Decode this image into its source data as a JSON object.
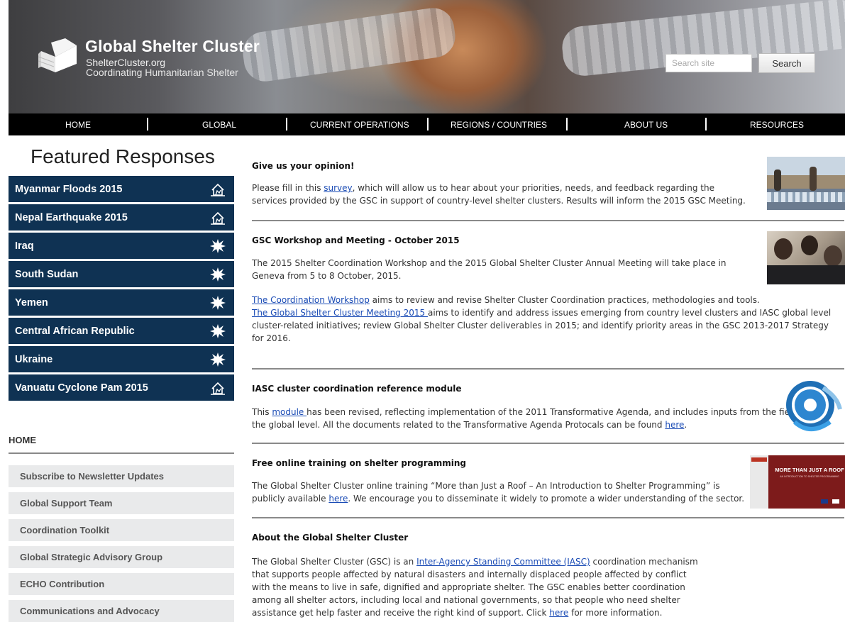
{
  "header": {
    "site_title": "Global Shelter Cluster",
    "site_url": "ShelterCluster.org",
    "tagline": "Coordinating Humanitarian Shelter",
    "search_placeholder": "Search site",
    "search_button": "Search"
  },
  "nav": [
    "HOME",
    "GLOBAL",
    "CURRENT OPERATIONS",
    "REGIONS / COUNTRIES",
    "ABOUT US",
    "RESOURCES"
  ],
  "sidebar": {
    "featured_heading": "Featured Responses",
    "responses": [
      {
        "label": "Myanmar Floods 2015",
        "icon": "house-disaster-icon"
      },
      {
        "label": "Nepal Earthquake 2015",
        "icon": "house-disaster-icon"
      },
      {
        "label": "Iraq",
        "icon": "burst-icon"
      },
      {
        "label": "South Sudan",
        "icon": "burst-icon"
      },
      {
        "label": "Yemen",
        "icon": "burst-icon"
      },
      {
        "label": "Central African Republic",
        "icon": "burst-icon"
      },
      {
        "label": "Ukraine",
        "icon": "burst-icon"
      },
      {
        "label": "Vanuatu Cyclone Pam 2015",
        "icon": "house-disaster-icon"
      }
    ],
    "home_heading": "HOME",
    "links": [
      "Subscribe to Newsletter Updates",
      "Global Support Team",
      "Coordination Toolkit",
      "Global Strategic Advisory Group",
      "ECHO Contribution",
      "Communications and Advocacy"
    ]
  },
  "posts": {
    "opinion": {
      "title": "Give us your opinion!",
      "p1_a": "Please fill in this ",
      "p1_link": "survey",
      "p1_b": ", which will allow us to hear about your priorities, needs, and feedback regarding the services provided by the GSC in support of country-level shelter clusters. Results will inform the 2015 GSC Meeting."
    },
    "workshop": {
      "title": "GSC Workshop and Meeting - October 2015",
      "p1": "The 2015 Shelter Coordination Workshop and the 2015 Global Shelter Cluster Annual Meeting will take place in Geneva from 5 to 8 October, 2015.",
      "link1": "The Coordination Workshop",
      "text1": " aims to review and revise Shelter Cluster Coordination practices, methodologies and tools.",
      "link2": "The Global Shelter Cluster Meeting 2015 ",
      "text2": "aims to identify and address issues emerging from country level clusters and IASC global level cluster-related initiatives; review Global Shelter Cluster deliverables in 2015; and identify priority areas in the GSC 2013-2017 Strategy for 2016."
    },
    "iasc": {
      "title": "IASC cluster coordination reference module",
      "a": "This ",
      "link": "module ",
      "b": "has been revised, reflecting implementation of the 2011 Transformative Agenda, and includes inputs from the field and the global level. All the documents related to the Transformative Agenda Protocals can be found ",
      "link2": "here",
      "c": "."
    },
    "training": {
      "title": "Free online training on shelter programming",
      "a": "The Global Shelter Cluster online training “More than Just a Roof – An Introduction to Shelter Programming” is publicly available ",
      "link": "here",
      "b": ". We encourage you to disseminate it widely to promote a wider understanding of the sector.",
      "thumb_title": "MORE THAN JUST A ROOF",
      "thumb_sub": "AN INTRODUCTION TO SHELTER PROGRAMMING"
    },
    "about": {
      "title": "About the Global Shelter Cluster",
      "a": "The Global Shelter Cluster (GSC) is an ",
      "link": "Inter-Agency Standing Committee (IASC)",
      "b": " coordination mechanism that supports people affected by natural disasters and internally displaced people affected by conflict with the means to live in safe, dignified and appropriate shelter. The GSC enables better coordination among all shelter actors, including local and national governments, so that people who need shelter assistance get help faster and receive the right kind of support. Click ",
      "link2": "here",
      "c": " for more information."
    }
  },
  "colors": {
    "nav_bg": "#000000",
    "response_bg": "#0f3253",
    "sidelink_bg": "#e9eaeb",
    "link": "#1a4bb5"
  }
}
